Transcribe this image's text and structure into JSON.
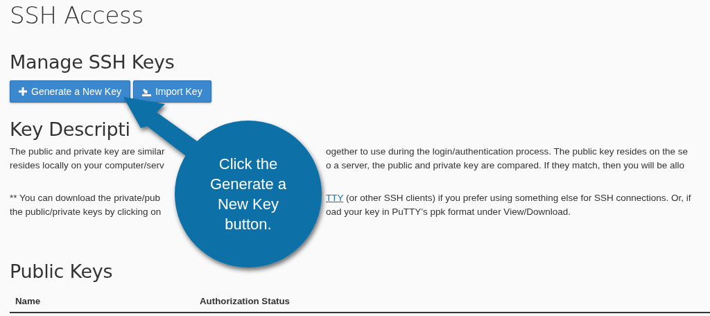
{
  "page_title": "SSH Access",
  "manage": {
    "title": "Manage SSH Keys",
    "buttons": [
      {
        "label": "Generate a New Key"
      },
      {
        "label": "Import Key"
      }
    ]
  },
  "description": {
    "title": "Key Descripti",
    "paragraphs": [
      [
        {
          "left": [
            {
              "kind": "text",
              "text": "The public and private key are similar"
            }
          ],
          "right": [
            {
              "kind": "text",
              "text": "ogether to use during the login/authentication process. The public key resides on the se"
            }
          ]
        },
        {
          "left": [
            {
              "kind": "text",
              "text": "resides locally on your computer/serv"
            }
          ],
          "right": [
            {
              "kind": "text",
              "text": "o a server, the public and private key are compared. If they match, then you will be allo"
            }
          ]
        }
      ],
      [
        {
          "left": [
            {
              "kind": "text",
              "text": "** You can download the private/pub"
            }
          ],
          "right": [
            {
              "kind": "link",
              "text": "TTY"
            },
            {
              "kind": "text",
              "text": " (or other SSH clients) if you prefer using something else for SSH connections. Or, if"
            }
          ]
        },
        {
          "left": [
            {
              "kind": "text",
              "text": "the public/private keys by clicking on"
            }
          ],
          "right": [
            {
              "kind": "text",
              "text": "oad your key in PuTTY’s ppk format under View/Download."
            }
          ]
        }
      ]
    ]
  },
  "public_keys": {
    "title": "Public Keys",
    "columns": [
      "Name",
      "Authorization Status"
    ]
  },
  "callout": {
    "lines": [
      "Click the",
      "Generate a",
      "New Key",
      "button."
    ]
  }
}
